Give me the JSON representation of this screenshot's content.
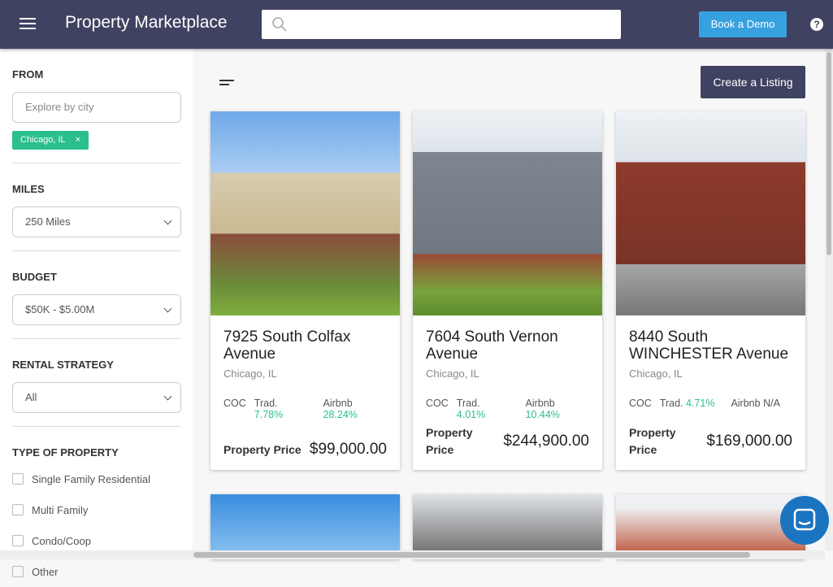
{
  "header": {
    "title": "Property Marketplace",
    "search_placeholder": "",
    "book_demo": "Book a Demo",
    "help": "?"
  },
  "sidebar": {
    "from_label": "FROM",
    "city_placeholder": "Explore by city",
    "chip": "Chicago, IL",
    "chip_close": "×",
    "miles_label": "MILES",
    "miles_value": "250 Miles",
    "budget_label": "BUDGET",
    "budget_value": "$50K - $5.00M",
    "rental_label": "RENTAL STRATEGY",
    "rental_value": "All",
    "type_label": "TYPE OF PROPERTY",
    "types": [
      "Single Family Residential",
      "Multi Family",
      "Condo/Coop",
      "Other"
    ]
  },
  "main": {
    "create_listing": "Create a Listing",
    "listings": [
      {
        "address": "7925 South Colfax Avenue",
        "city": "Chicago, IL",
        "coc": "COC",
        "trad_label": "Trad.",
        "trad": "7.78%",
        "airbnb_label": "Airbnb",
        "airbnb": "28.24%",
        "price_label": "Property Price",
        "price": "$99,000.00"
      },
      {
        "address": "7604 South Vernon Avenue",
        "city": "Chicago, IL",
        "coc": "COC",
        "trad_label": "Trad.",
        "trad": "4.01%",
        "airbnb_label": "Airbnb",
        "airbnb": "10.44%",
        "price_label": "Property Price",
        "price": "$244,900.00"
      },
      {
        "address": "8440 South WINCHESTER Avenue",
        "city": "Chicago, IL",
        "coc": "COC",
        "trad_label": "Trad.",
        "trad": "4.71%",
        "airbnb_label": "Airbnb",
        "airbnb": "N/A",
        "price_label": "Property Price",
        "price": "$169,000.00"
      }
    ]
  },
  "colors": {
    "header": "#3f4261",
    "accent": "#37a1e0",
    "green": "#2bbf8e"
  }
}
